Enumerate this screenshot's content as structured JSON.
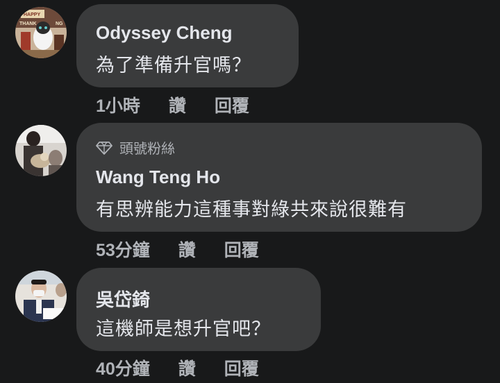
{
  "comments": [
    {
      "author": "Odyssey Cheng",
      "badge": "",
      "text": "為了準備升官嗎？",
      "time": "1小時",
      "like_label": "讚",
      "reply_label": "回覆",
      "avatar_icon": "avatar-photo-cat-happy-thanksgiving"
    },
    {
      "author": "Wang Teng Ho",
      "badge": "頭號粉絲",
      "text": "有思辨能力這種事對綠共來說很難有",
      "time": "53分鐘",
      "like_label": "讚",
      "reply_label": "回覆",
      "avatar_icon": "avatar-photo-person-with-dog"
    },
    {
      "author": "吳岱錡",
      "badge": "",
      "text": "這機師是想升官吧？",
      "time": "40分鐘",
      "like_label": "讚",
      "reply_label": "回覆",
      "avatar_icon": "avatar-photo-man-with-mask"
    }
  ],
  "colors": {
    "background": "#18191a",
    "bubble": "#3a3b3c",
    "primary_text": "#e4e6eb",
    "secondary_text": "#b0b3b8"
  }
}
